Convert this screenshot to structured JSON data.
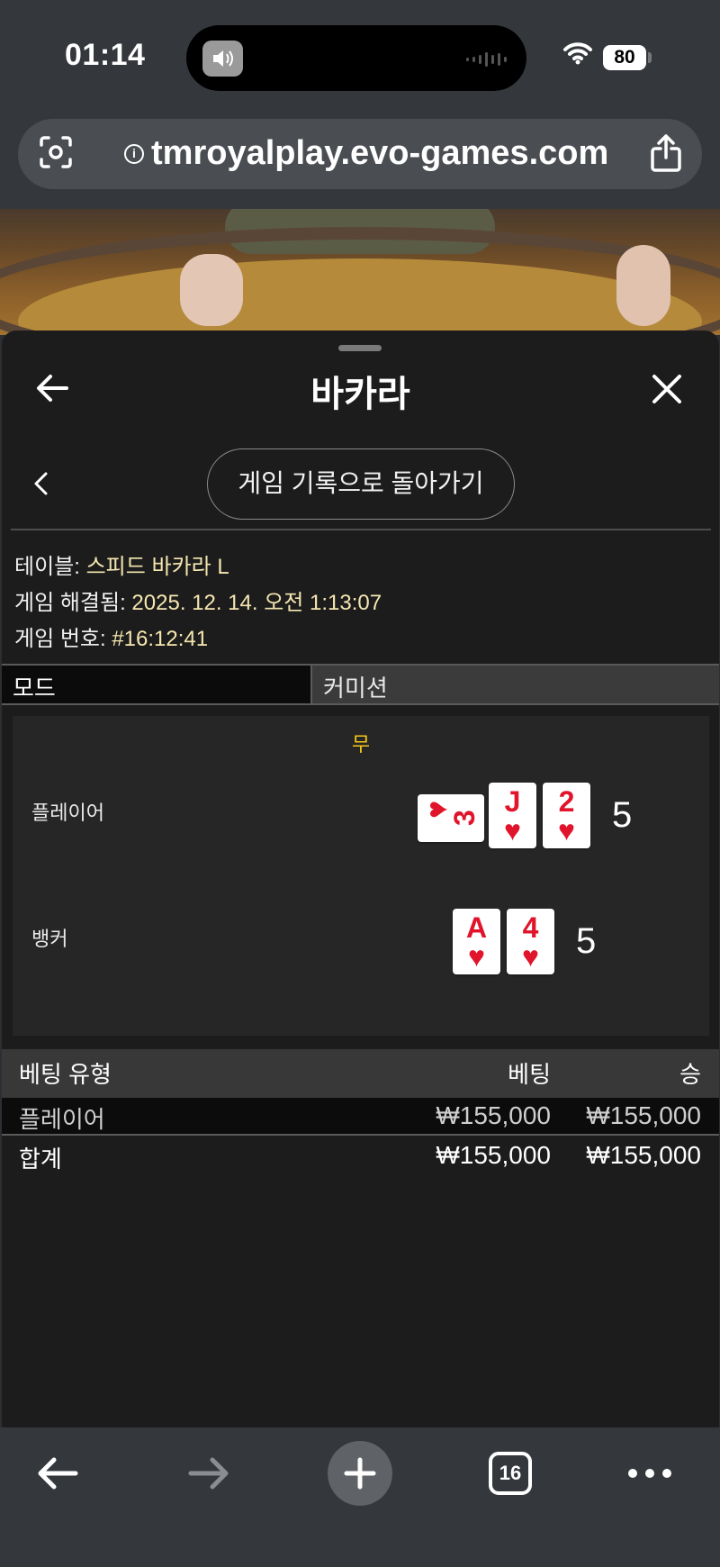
{
  "status": {
    "time": "01:14",
    "battery": "80"
  },
  "browser": {
    "url": "tmroyalplay.evo-games.com",
    "tab_count": "16"
  },
  "sheet": {
    "title": "바카라",
    "history_button": "게임 기록으로 돌아가기",
    "meta": {
      "table_label": "테이블:",
      "table_value": "스피드 바카라 L",
      "resolved_label": "게임 해결됨:",
      "resolved_value": "2025. 12. 14. 오전 1:13:07",
      "game_no_label": "게임 번호:",
      "game_no_value": "#16:12:41"
    },
    "tabs": {
      "mode": "모드",
      "commission": "커미션"
    },
    "result": {
      "outcome": "무",
      "player_label": "플레이어",
      "player_score": "5",
      "player_cards": [
        {
          "rank": "3",
          "suit": "♥",
          "sideways": true
        },
        {
          "rank": "J",
          "suit": "♥"
        },
        {
          "rank": "2",
          "suit": "♥"
        }
      ],
      "banker_label": "뱅커",
      "banker_score": "5",
      "banker_cards": [
        {
          "rank": "A",
          "suit": "♥"
        },
        {
          "rank": "4",
          "suit": "♥"
        }
      ]
    },
    "bets": {
      "headers": {
        "type": "베팅 유형",
        "bet": "베팅",
        "win": "승"
      },
      "rows": [
        {
          "type": "플레이어",
          "bet": "₩155,000",
          "win": "₩155,000"
        }
      ],
      "total": {
        "type": "합계",
        "bet": "₩155,000",
        "win": "₩155,000"
      }
    }
  },
  "colors": {
    "meta_value": "#f5e6b0",
    "outcome": "#f5c518",
    "card_red": "#e0142a"
  }
}
